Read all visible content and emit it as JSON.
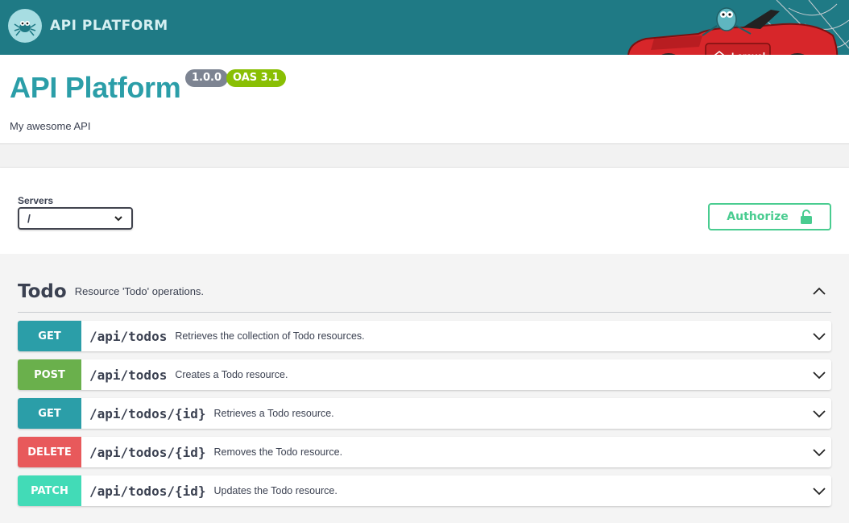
{
  "topbar": {
    "brand_text": "API PLATFORM",
    "car_badge_text": "Laravel"
  },
  "info": {
    "title": "API Platform",
    "version_badge": "1.0.0",
    "oas_badge": "OAS 3.1",
    "description": "My awesome API"
  },
  "servers": {
    "label": "Servers",
    "selected": "/"
  },
  "authorize": {
    "label": "Authorize"
  },
  "tag": {
    "name": "Todo",
    "description": "Resource 'Todo' operations."
  },
  "operations": [
    {
      "method": "GET",
      "path": "/api/todos",
      "summary": "Retrieves the collection of Todo resources."
    },
    {
      "method": "POST",
      "path": "/api/todos",
      "summary": "Creates a Todo resource."
    },
    {
      "method": "GET",
      "path": "/api/todos/{id}",
      "summary": "Retrieves a Todo resource."
    },
    {
      "method": "DELETE",
      "path": "/api/todos/{id}",
      "summary": "Removes the Todo resource."
    },
    {
      "method": "PATCH",
      "path": "/api/todos/{id}",
      "summary": "Updates the Todo resource."
    }
  ],
  "colors": {
    "topbar": "#1f7a85",
    "title": "#2b9ea8",
    "get": "#2b9ea8",
    "post": "#6ab04c",
    "delete": "#e8595b",
    "patch": "#42dbb7",
    "authorize": "#49cc90"
  },
  "icons": {
    "brand": "spider-logo-icon",
    "select": "chevron-down-icon",
    "authorize": "unlock-icon",
    "tag_toggle": "chevron-up-icon",
    "operation_toggle": "chevron-down-icon"
  }
}
